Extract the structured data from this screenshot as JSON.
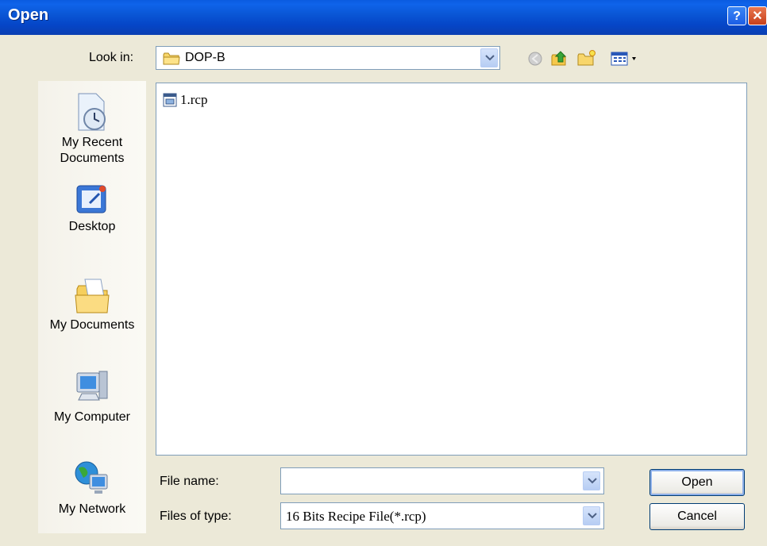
{
  "window": {
    "title": "Open",
    "help_icon": "help-icon",
    "close_icon": "close-icon"
  },
  "lookin": {
    "label": "Look in:",
    "value": "DOP-B",
    "icon": "folder-icon"
  },
  "toolbar": {
    "icons": [
      "back-icon",
      "up-folder-icon",
      "new-folder-icon",
      "view-menu-icon"
    ]
  },
  "places": [
    {
      "label": "My Recent\nDocuments",
      "icon": "recent-documents-icon"
    },
    {
      "label": "Desktop",
      "icon": "desktop-icon"
    },
    {
      "label": "My Documents",
      "icon": "my-documents-icon"
    },
    {
      "label": "My Computer",
      "icon": "my-computer-icon"
    },
    {
      "label": "My Network",
      "icon": "my-network-icon"
    }
  ],
  "files": [
    {
      "name": "1.rcp",
      "icon": "recipe-file-icon"
    }
  ],
  "filename": {
    "label": "File name:",
    "value": ""
  },
  "filetype": {
    "label": "Files of type:",
    "value": "16 Bits Recipe File(*.rcp)"
  },
  "buttons": {
    "open": "Open",
    "cancel": "Cancel"
  }
}
